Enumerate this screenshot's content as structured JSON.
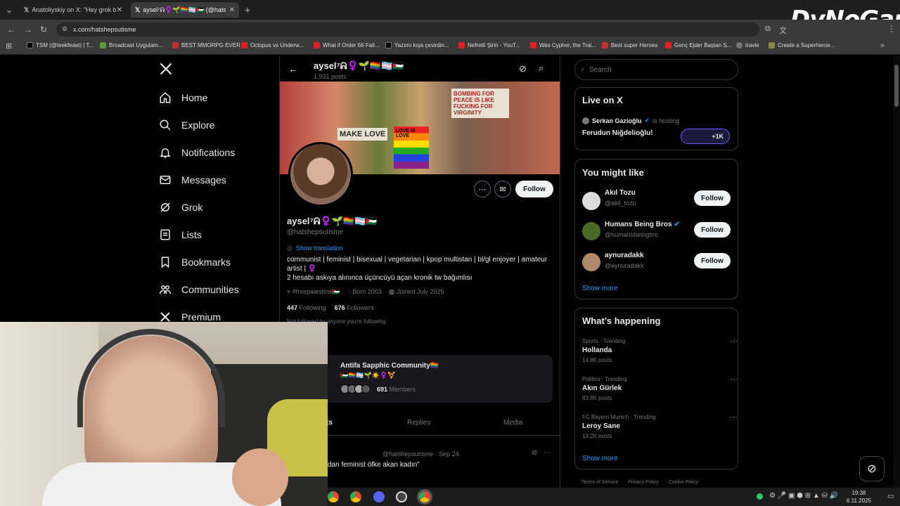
{
  "browser": {
    "tabs": [
      {
        "label": "Anatoliyskiy on X: \"Hey grok bi"
      },
      {
        "label": "aysel⁷ᕱ♀️🌱🏳️‍🌈🏳️‍⚧️🇵🇸 (@hatshe"
      }
    ],
    "url": "x.com/hatshepsutisme",
    "bookmarks": [
      {
        "label": "TSM (@teekfeast) | T...",
        "color": "#000000"
      },
      {
        "label": "Broadcast Uygulam...",
        "color": "#5a9a3a"
      },
      {
        "label": "BEST MMORPG EVER",
        "color": "#c03030"
      },
      {
        "label": "Octopus vs Underw...",
        "color": "#e02020"
      },
      {
        "label": "What if Order 66 Fail...",
        "color": "#e02020"
      },
      {
        "label": "Yazımı kışa çevirdin...",
        "color": "#000000"
      },
      {
        "label": "Nefretli Şirin - YouT...",
        "color": "#e02020"
      },
      {
        "label": "Was Cypher, the Trai...",
        "color": "#e02020"
      },
      {
        "label": "Best super Heroes",
        "color": "#c03030"
      },
      {
        "label": "Genç Ejder Baştan S...",
        "color": "#e02020"
      },
      {
        "label": "travle",
        "color": "#777777"
      },
      {
        "label": "Create a Superheroe...",
        "color": "#888844"
      }
    ]
  },
  "overlay": {
    "brand": "DyNoGame"
  },
  "nav": {
    "items": [
      {
        "label": "Home",
        "icon": "home-icon"
      },
      {
        "label": "Explore",
        "icon": "search-icon"
      },
      {
        "label": "Notifications",
        "icon": "bell-icon"
      },
      {
        "label": "Messages",
        "icon": "mail-icon"
      },
      {
        "label": "Grok",
        "icon": "grok-icon"
      },
      {
        "label": "Lists",
        "icon": "list-icon"
      },
      {
        "label": "Bookmarks",
        "icon": "bookmark-icon"
      },
      {
        "label": "Communities",
        "icon": "communities-icon"
      },
      {
        "label": "Premium",
        "icon": "x-logo-icon"
      }
    ]
  },
  "profile": {
    "header_name": "aysel⁷ᕱ♀️🌱🏳️‍🌈🏳️‍⚧️🇵🇸",
    "header_posts": "1,931 posts",
    "banner_signs": [
      "MAKE LOVE",
      "BOMBING FOR PEACE IS LIKE FUCKING FOR VIRGINITY",
      "LOVE IS LOVE"
    ],
    "name": "aysel⁷ᕱ♀️🌱🏳️‍🌈🏳️‍⚧️🇵🇸",
    "handle": "@hatshepsutisme",
    "follow_label": "Follow",
    "show_translation": "Show translation",
    "bio_line1": "communist | feminist | bisexual | vegetarian | kpop multistan | bl/gl enjoyer | amateur",
    "bio_line2": "artist | ♀️",
    "bio_line3": "2 hesabı askıya alınınca üçüncüyü açan kronik tw bağımlısı",
    "location": "#freepalestine🇵🇸",
    "born": "Born 2003",
    "joined": "Joined July 2025",
    "following_count": "447",
    "following_label": "Following",
    "followers_count": "676",
    "followers_label": "Followers",
    "not_followed": "Not followed by anyone you're following",
    "communities_heading_partial": "s",
    "community_name": "Antifa Sapphic Community🏳️‍🌈",
    "community_emoji": "🇵🇸🏳️‍🌈🏳️‍⚧️🌱☀️♀️⚧️",
    "community_members_count": "691",
    "community_members_label": "Members",
    "tabs": [
      "ts",
      "Replies",
      "Media"
    ],
    "post_handle_time": "@hatshepsutisme · Sep 24",
    "post_text": "dan feminist öfke akan kadın\""
  },
  "right": {
    "search_placeholder": "Search",
    "live_title": "Live on X",
    "live_host": "Serkan Gazioğlu",
    "live_hosting": "is hosting",
    "live_topic": "Ferudun Niğdelioğlu!",
    "live_count": "+1K",
    "might_like_title": "You might like",
    "suggestions": [
      {
        "name": "Akıl Tozu",
        "handle": "@akil_tozu",
        "follow": "Follow"
      },
      {
        "name": "Humans Being Bros",
        "handle": "@humansbeingbro",
        "follow": "Follow"
      },
      {
        "name": "aynuradakk",
        "handle": "@aynuradakk",
        "follow": "Follow"
      }
    ],
    "show_more": "Show more",
    "happening_title": "What’s happening",
    "trends": [
      {
        "context": "Sports · Trending",
        "name": "Hollanda",
        "posts": "14.8K posts"
      },
      {
        "context": "Politics · Trending",
        "name": "Akın Gürlek",
        "posts": "83.8K posts"
      },
      {
        "context": "FC Bayern Munich · Trending",
        "name": "Leroy Sane",
        "posts": "13.2K posts"
      }
    ],
    "show_more2": "Show more",
    "footer": [
      "Terms of Service",
      "Privacy Policy",
      "Cookie Policy"
    ]
  },
  "taskbar": {
    "time": "19:38",
    "date": "6.11.2025"
  }
}
